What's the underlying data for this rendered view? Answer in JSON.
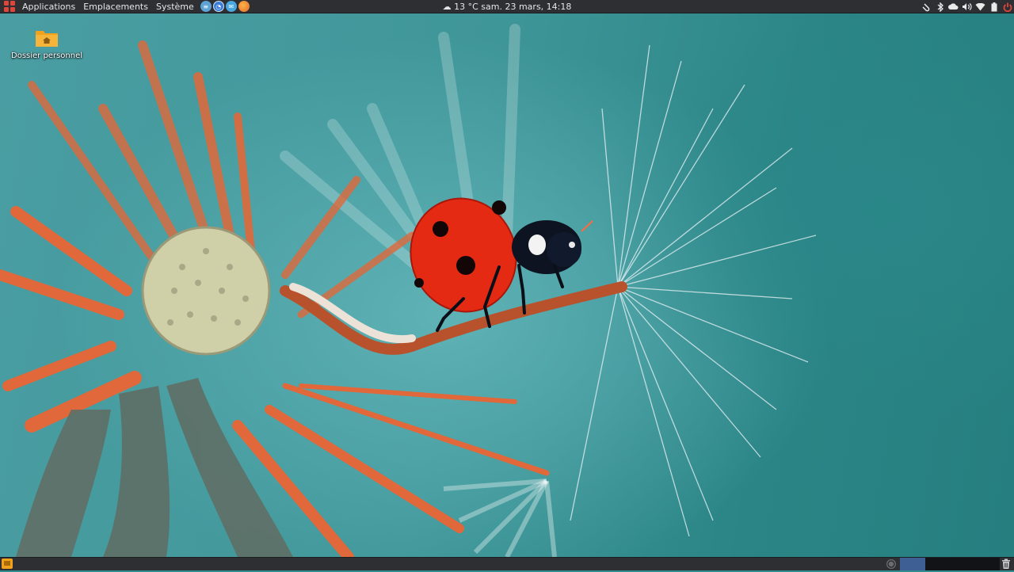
{
  "top_panel": {
    "menus": {
      "applications": "Applications",
      "places": "Emplacements",
      "system": "Système"
    },
    "launchers": [
      {
        "name": "text-editor-icon",
        "color": "#5ea3d6"
      },
      {
        "name": "browser-icon",
        "color": "#3b7dd8"
      },
      {
        "name": "mail-icon",
        "color": "#4aa8e0"
      },
      {
        "name": "firefox-icon",
        "color": "#e06a2b"
      }
    ],
    "weather_icon": "cloud-icon",
    "weather_temp": "13 °C",
    "datetime": "sam. 23 mars, 14:18",
    "tray_icons": [
      "clip-icon",
      "bluetooth-icon",
      "cloud-icon",
      "volume-icon",
      "wifi-icon",
      "battery-icon",
      "power-icon"
    ],
    "power_color": "#e0453a"
  },
  "desktop": {
    "home_folder_label": "Dossier personnel",
    "folder_color": "#f0a21d"
  },
  "bottom_panel": {
    "show_desktop_color": "#f0a21d",
    "workspace_active_color": "#3d5f93"
  }
}
